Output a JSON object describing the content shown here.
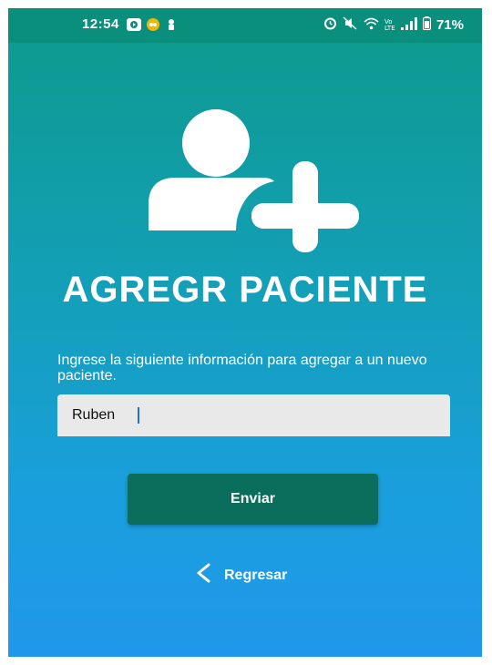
{
  "status_bar": {
    "time": "12:54",
    "battery_percent": "71%",
    "left_icons": [
      "youtube-icon",
      "app-icon",
      "notification-icon"
    ],
    "right_icons": [
      "alarm-icon",
      "mute-icon",
      "wifi-icon",
      "lte-icon",
      "signal-icon",
      "battery-icon"
    ]
  },
  "header": {
    "icon": "add-user-icon",
    "title": "AGREGR PACIENTE"
  },
  "form": {
    "instructions": "Ingrese la siguiente información para agregar a un nuevo paciente.",
    "name_value": "Ruben",
    "submit_label": "Enviar"
  },
  "navigation": {
    "back_label": "Regresar",
    "back_icon": "chevron-left-icon"
  },
  "colors": {
    "status_bar": "#0a8f7d",
    "gradient_top": "#0d9a8c",
    "gradient_bottom": "#2097ea",
    "button": "#0b6d5c",
    "input_bg": "#e9e9e9"
  }
}
